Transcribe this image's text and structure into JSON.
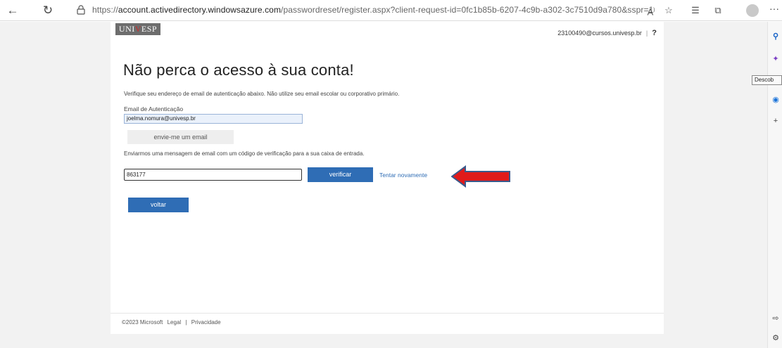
{
  "browser": {
    "url_prefix": "https://",
    "url_host": "account.activedirectory.windowsazure.com",
    "url_path": "/passwordreset/register.aspx?client-request-id=0fc1b85b-6207-4c9b-a302-3c7510d9a780&sspr=1",
    "read_aloud": "A",
    "more": "···"
  },
  "header": {
    "logo": {
      "pre": "UNI",
      "v": "V",
      "post": "ESP"
    },
    "user": "23100490@cursos.univesp.br",
    "separator": "|",
    "help": "?"
  },
  "main": {
    "title": "Não perca o acesso à sua conta!",
    "description": "Verifique seu endereço de email de autenticação abaixo. Não utilize seu email escolar ou corporativo primário.",
    "email_label": "Email de Autenticação",
    "email_value": "joelma.nomura@univesp.br",
    "send_button": "envie-me um email",
    "sent_message": "Enviarmos uma mensagem de email com um código de verificação para a sua caixa de entrada.",
    "code_value": "863177",
    "verify_button": "verificar",
    "retry_link": "Tentar novamente",
    "back_button": "voltar"
  },
  "footer": {
    "copyright": "©2023 Microsoft",
    "legal": "Legal",
    "separator": "|",
    "privacy": "Privacidade"
  },
  "sidebar": {
    "tooltip": "Descob"
  },
  "colors": {
    "accent": "#2f6db5",
    "arrow_fill": "#e01b1b",
    "arrow_stroke": "#3a5a8c"
  }
}
